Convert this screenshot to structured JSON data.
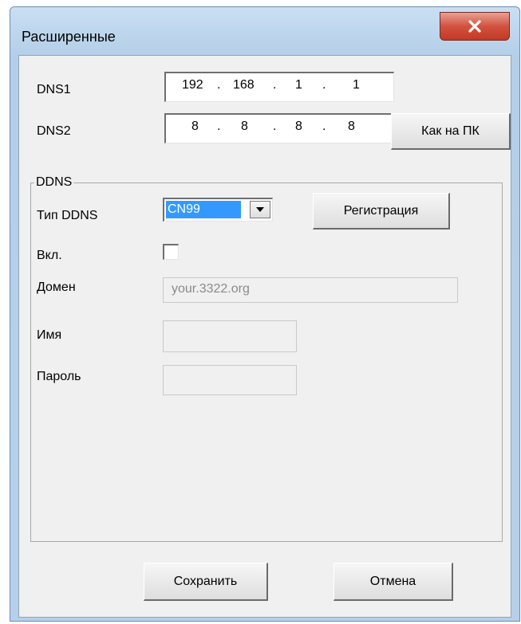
{
  "window": {
    "title": "Расширенные",
    "close_label": "X"
  },
  "dns": {
    "dns1_label": "DNS1",
    "dns1_octets": [
      "192",
      "168",
      "1",
      "1"
    ],
    "dns2_label": "DNS2",
    "dns2_octets": [
      "8",
      "8",
      "8",
      "8"
    ],
    "separator": ".",
    "same_as_pc_label": "Как на ПК"
  },
  "ddns": {
    "group_label": "DDNS",
    "type_label": "Тип DDNS",
    "type_value": "CN99",
    "register_label": "Регистрация",
    "enable_label": "Вкл.",
    "enabled": false,
    "domain_label": "Домен",
    "domain_placeholder": "your.3322.org",
    "name_label": "Имя",
    "password_label": "Пароль"
  },
  "footer": {
    "save_label": "Сохранить",
    "cancel_label": "Отмена"
  },
  "colors": {
    "selection": "#3399ff",
    "close_button": "#c9432f",
    "frame": "#b9d1ea"
  }
}
